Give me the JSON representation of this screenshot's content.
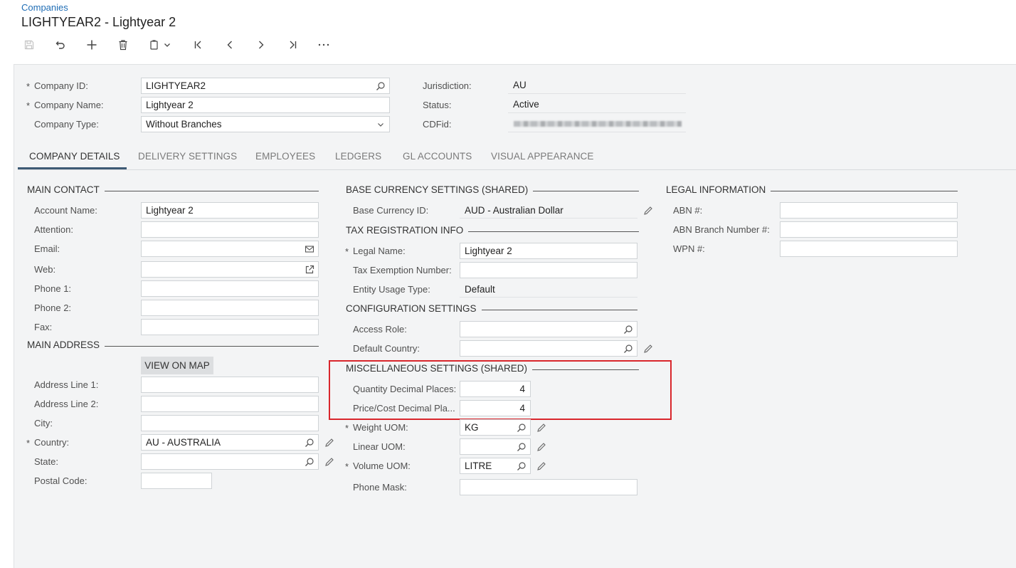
{
  "breadcrumb": "Companies",
  "page_title": "LIGHTYEAR2 - Lightyear 2",
  "header_fields": {
    "company_id_label": "Company ID:",
    "company_id_value": "LIGHTYEAR2",
    "company_name_label": "Company Name:",
    "company_name_value": "Lightyear 2",
    "company_type_label": "Company Type:",
    "company_type_value": "Without Branches",
    "jurisdiction_label": "Jurisdiction:",
    "jurisdiction_value": "AU",
    "status_label": "Status:",
    "status_value": "Active",
    "cdfid_label": "CDFid:"
  },
  "required_mark": "*",
  "tabs": [
    "COMPANY DETAILS",
    "DELIVERY SETTINGS",
    "EMPLOYEES",
    "LEDGERS",
    "GL ACCOUNTS",
    "VISUAL APPEARANCE"
  ],
  "main_contact": {
    "title": "MAIN CONTACT",
    "account_name_label": "Account Name:",
    "account_name_value": "Lightyear 2",
    "attention_label": "Attention:",
    "email_label": "Email:",
    "web_label": "Web:",
    "phone1_label": "Phone 1:",
    "phone2_label": "Phone 2:",
    "fax_label": "Fax:"
  },
  "main_address": {
    "title": "MAIN ADDRESS",
    "view_on_map": "VIEW ON MAP",
    "address1_label": "Address Line 1:",
    "address2_label": "Address Line 2:",
    "city_label": "City:",
    "country_label": "Country:",
    "country_value": "AU - AUSTRALIA",
    "state_label": "State:",
    "postal_label": "Postal Code:"
  },
  "base_currency": {
    "title": "BASE CURRENCY SETTINGS (SHARED)",
    "currency_label": "Base Currency ID:",
    "currency_value": "AUD - Australian Dollar"
  },
  "tax_registration": {
    "title": "TAX REGISTRATION INFO",
    "legal_name_label": "Legal Name:",
    "legal_name_value": "Lightyear 2",
    "tax_exemption_label": "Tax Exemption Number:",
    "entity_usage_label": "Entity Usage Type:",
    "entity_usage_value": "Default"
  },
  "configuration": {
    "title": "CONFIGURATION SETTINGS",
    "access_role_label": "Access Role:",
    "default_country_label": "Default Country:"
  },
  "miscellaneous": {
    "title": "MISCELLANEOUS SETTINGS (SHARED)",
    "qty_decimal_label": "Quantity Decimal Places:",
    "qty_decimal_value": "4",
    "price_decimal_label": "Price/Cost Decimal Pla...",
    "price_decimal_value": "4",
    "weight_uom_label": "Weight UOM:",
    "weight_uom_value": "KG",
    "linear_uom_label": "Linear UOM:",
    "volume_uom_label": "Volume UOM:",
    "volume_uom_value": "LITRE",
    "phone_mask_label": "Phone Mask:"
  },
  "legal_information": {
    "title": "LEGAL INFORMATION",
    "abn_label": "ABN #:",
    "abn_branch_label": "ABN Branch Number #:",
    "wpn_label": "WPN #:"
  },
  "colors": {
    "link": "#1f6db5",
    "highlight": "#d9262c",
    "tab_indicator": "#3d5a74",
    "panel_bg": "#f3f4f5"
  }
}
